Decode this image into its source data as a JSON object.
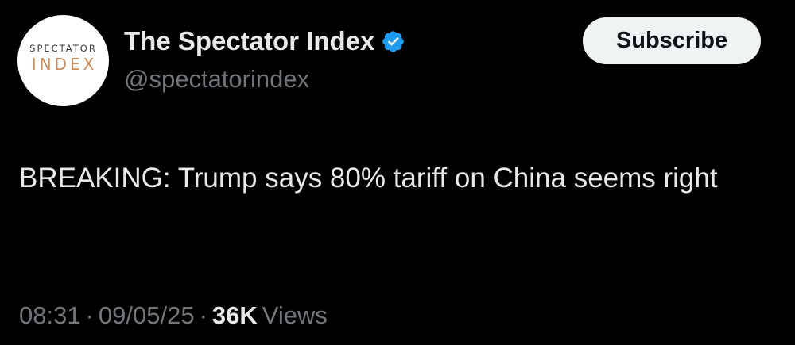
{
  "author": {
    "avatar_logo_top": "SPECTATOR",
    "avatar_logo_bottom": "INDEX",
    "display_name": "The Spectator Index",
    "handle": "@spectatorindex",
    "verified_icon": "verified-badge-icon",
    "verified_color": "#1d9bf0"
  },
  "actions": {
    "subscribe_label": "Subscribe"
  },
  "tweet": {
    "text": "BREAKING: Trump says 80% tariff on China seems right",
    "time": "08:31",
    "separator": "·",
    "date": "09/05/25",
    "views_count": "36K",
    "views_label": "Views"
  },
  "colors": {
    "background": "#000000",
    "text_primary": "#e7e9ea",
    "text_secondary": "#71767b",
    "button_bg": "#eff3f4",
    "logo_accent": "#c98a57"
  }
}
